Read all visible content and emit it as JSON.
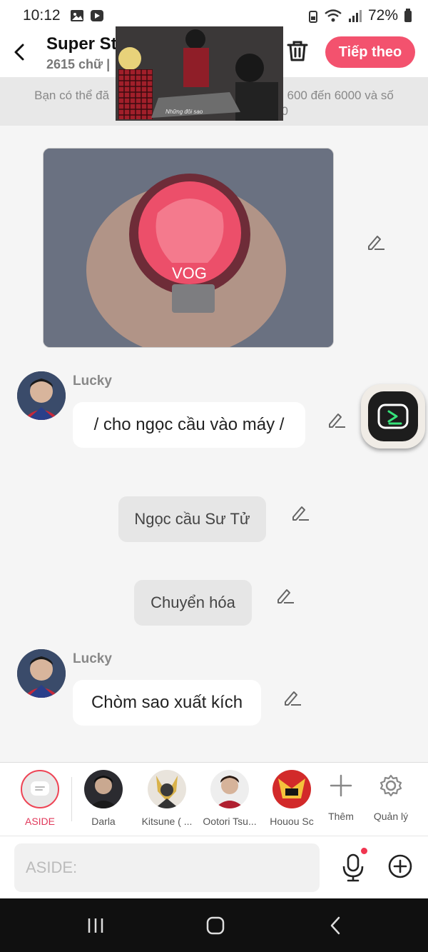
{
  "status": {
    "time": "10:12",
    "battery": "72%"
  },
  "header": {
    "title": "Super Sta",
    "subtitle": "2615 chữ |",
    "follow_label": "Tiếp theo"
  },
  "notice": {
    "line1": "Bạn có thể đă",
    "line1_tail": "600 đến 6000 và số",
    "line2_tail": "0"
  },
  "overlay": {
    "caption": "Những đôi sao"
  },
  "messages": [
    {
      "type": "image"
    },
    {
      "type": "speech",
      "name": "Lucky",
      "text": "/ cho ngọc cầu vào máy /"
    },
    {
      "type": "aside",
      "text": "Ngọc cầu Sư Tử"
    },
    {
      "type": "aside",
      "text": "Chuyển hóa"
    },
    {
      "type": "speech",
      "name": "Lucky",
      "text": "Chòm sao xuất kích"
    }
  ],
  "characters": [
    {
      "label": "ASIDE"
    },
    {
      "label": "Darla"
    },
    {
      "label": "Kitsune ( ..."
    },
    {
      "label": "Ootori Tsu..."
    },
    {
      "label": "Houou Sc"
    }
  ],
  "actions": {
    "add_label": "Thêm",
    "manage_label": "Quản lý"
  },
  "composer": {
    "placeholder": "ASIDE:"
  },
  "colors": {
    "accent": "#f3526e",
    "aside_selected": "#e0385a"
  }
}
